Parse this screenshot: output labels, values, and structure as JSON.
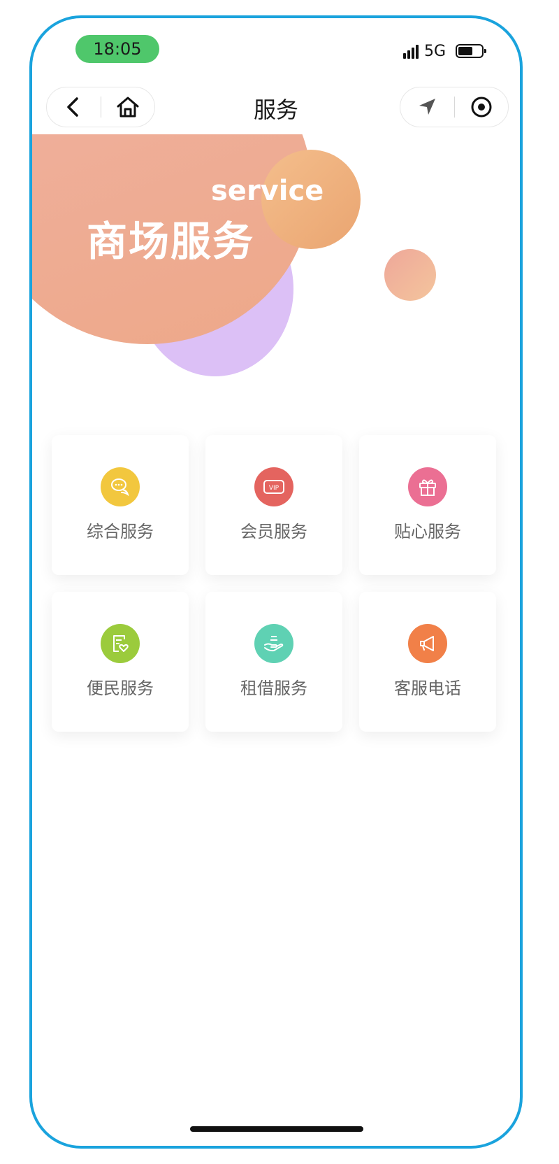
{
  "status_bar": {
    "time": "18:05",
    "network": "5G"
  },
  "nav": {
    "title": "服务",
    "back_icon": "chevron-left-icon",
    "home_icon": "home-icon",
    "location_icon": "navigation-arrow-icon",
    "record_icon": "target-icon"
  },
  "hero": {
    "subtitle": "service",
    "title": "商场服务"
  },
  "services": [
    {
      "label": "综合服务",
      "icon": "chat-bubbles-icon",
      "color": "#f2c73e"
    },
    {
      "label": "会员服务",
      "icon": "vip-icon",
      "color": "#e4645f"
    },
    {
      "label": "贴心服务",
      "icon": "gift-icon",
      "color": "#eb6f93"
    },
    {
      "label": "便民服务",
      "icon": "heart-document-icon",
      "color": "#9bcb3c"
    },
    {
      "label": "租借服务",
      "icon": "hand-giving-icon",
      "color": "#5fd1b3"
    },
    {
      "label": "客服电话",
      "icon": "megaphone-icon",
      "color": "#f18048"
    }
  ],
  "colors": {
    "frame": "#1aa3dd",
    "time_pill": "#4fc76b"
  }
}
